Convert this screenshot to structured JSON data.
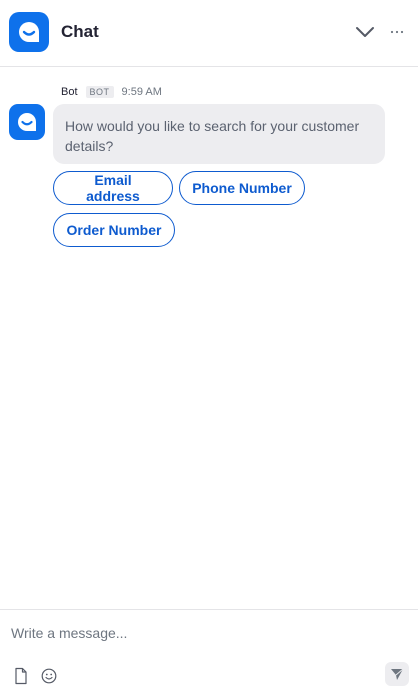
{
  "header": {
    "title": "Chat",
    "logo_icon": "chat-bubble-smile-icon",
    "collapse_icon": "chevron-down-icon",
    "more_icon": "more-horizontal-icon"
  },
  "message": {
    "sender": "Bot",
    "badge": "BOT",
    "time": "9:59 AM",
    "avatar_icon": "chat-bubble-smile-icon",
    "text": "How would you like to search for your customer details?"
  },
  "quick_replies": [
    {
      "label": "Email address"
    },
    {
      "label": "Phone Number"
    },
    {
      "label": "Order Number"
    }
  ],
  "composer": {
    "placeholder": "Write a message...",
    "file_icon": "file-icon",
    "emoji_icon": "emoji-icon",
    "send_icon": "send-icon"
  },
  "colors": {
    "accent": "#0e71eb",
    "button_text": "#0e5bcf",
    "bubble_bg": "#ededf0"
  }
}
